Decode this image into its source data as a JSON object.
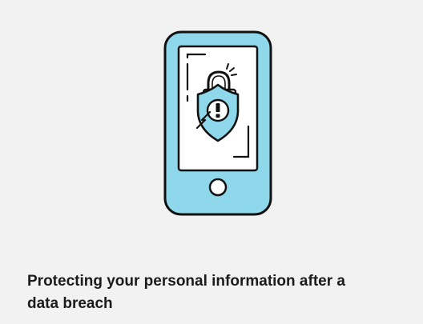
{
  "card": {
    "title": "Protecting your personal information after a data breach",
    "illustration": {
      "icon": "phone-lock-breach-icon",
      "colors": {
        "phone_body": "#8fd7ea",
        "screen": "#ffffff",
        "shield": "#8fd7ea",
        "outline": "#111111",
        "background": "#f2f2f2"
      }
    }
  }
}
